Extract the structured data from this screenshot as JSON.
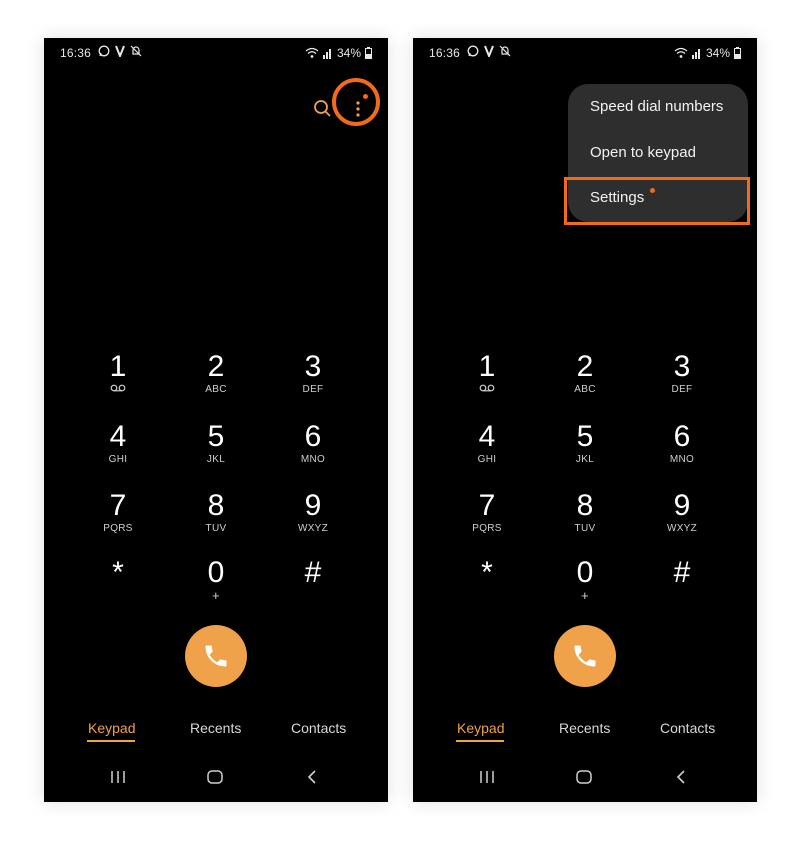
{
  "colors": {
    "accent": "#f0a24a",
    "highlight": "#f26a1b",
    "menu_bg": "#2e2e2e",
    "screen_bg": "#000000"
  },
  "status_bar": {
    "time": "16:36",
    "battery": "34%",
    "left_icons": [
      "whatsapp-icon",
      "v-app-icon",
      "bell-muted-icon"
    ],
    "right_icons": [
      "wifi-icon",
      "signal-icon",
      "battery-icon"
    ]
  },
  "keypad": {
    "keys": [
      {
        "digit": "1",
        "letters": "",
        "sub_icon": "voicemail-icon"
      },
      {
        "digit": "2",
        "letters": "ABC"
      },
      {
        "digit": "3",
        "letters": "DEF"
      },
      {
        "digit": "4",
        "letters": "GHI"
      },
      {
        "digit": "5",
        "letters": "JKL"
      },
      {
        "digit": "6",
        "letters": "MNO"
      },
      {
        "digit": "7",
        "letters": "PQRS"
      },
      {
        "digit": "8",
        "letters": "TUV"
      },
      {
        "digit": "9",
        "letters": "WXYZ"
      },
      {
        "digit": "*",
        "letters": ""
      },
      {
        "digit": "0",
        "letters": "+"
      },
      {
        "digit": "#",
        "letters": ""
      }
    ]
  },
  "tabs": [
    {
      "label": "Keypad",
      "active": true
    },
    {
      "label": "Recents",
      "active": false
    },
    {
      "label": "Contacts",
      "active": false
    }
  ],
  "menu": {
    "items": [
      "Speed dial numbers",
      "Open to keypad",
      "Settings"
    ]
  },
  "nav_icons": [
    "recent-apps-icon",
    "home-icon",
    "back-icon"
  ]
}
